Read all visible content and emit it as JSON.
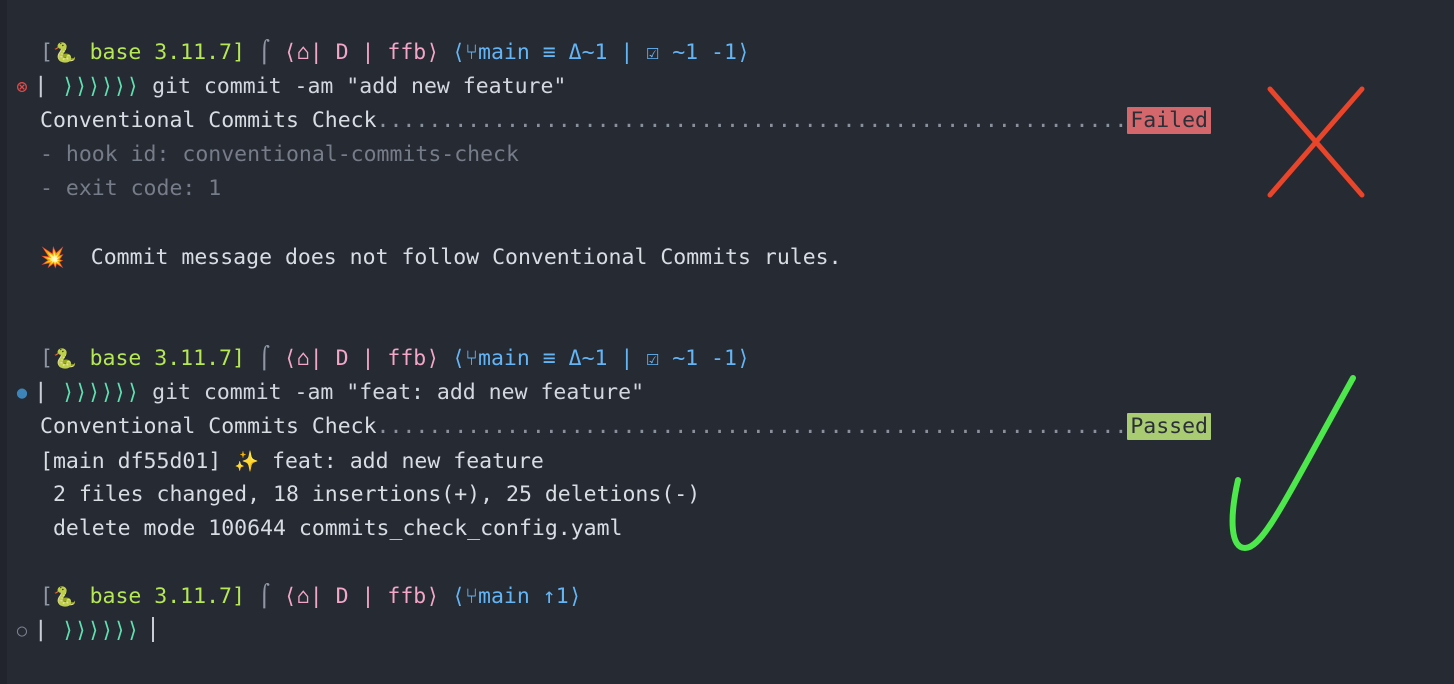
{
  "terminal": {
    "background": "#262a33",
    "foreground": "#c8cdd6",
    "title": "terminal-session"
  },
  "prompt": {
    "open_bracket": "[",
    "python_icon": "🐍",
    "env_label": "base 3.11.7",
    "close_bracket": "]",
    "separator": "⌠",
    "path_open": "⟨",
    "home_icon": "⌂",
    "path_pipe1": "|",
    "path_drive": "D",
    "path_pipe2": "|",
    "path_dir": "ffb",
    "path_close": "⟩",
    "git_open": "⟨",
    "branch_icon": "⑂",
    "branch_name": "main",
    "chevrons": "⟩⟩⟩⟩⟩⟩",
    "chevron_lead": "⎸"
  },
  "blocks": [
    {
      "marker": "error",
      "marker_glyph": "⊗",
      "git_status": "≡ Δ~1 | ☑ ~1 -1",
      "command": "git commit -am \"add new feature\"",
      "hook_label": "Conventional Commits Check",
      "hook_dots": "..........................................................",
      "hook_result": "Failed",
      "hook_result_color": "#d4676c",
      "detail_lines": [
        "- hook id: conventional-commits-check",
        "- exit code: 1"
      ],
      "message_emoji": "💥",
      "message": "Commit message does not follow Conventional Commits rules."
    },
    {
      "marker": "ok",
      "marker_glyph": "●",
      "git_status": "≡ Δ~1 | ☑ ~1 -1",
      "command": "git commit -am \"feat: add new feature\"",
      "hook_label": "Conventional Commits Check",
      "hook_dots": "..........................................................",
      "hook_result": "Passed",
      "hook_result_color": "#a9cc72",
      "commit_ref": "[main df55d01]",
      "commit_emoji": "✨",
      "commit_subject": "feat: add new feature",
      "stat_line": "2 files changed, 18 insertions(+), 25 deletions(-)",
      "mode_line": "delete mode 100644 commits_check_config.yaml"
    },
    {
      "marker": "idle",
      "marker_glyph": "○",
      "git_status": "↑1",
      "command": ""
    }
  ],
  "annotations": [
    {
      "name": "red-cross",
      "kind": "cross",
      "color": "#e8452a"
    },
    {
      "name": "green-check",
      "kind": "check",
      "color": "#4ce84c"
    }
  ]
}
